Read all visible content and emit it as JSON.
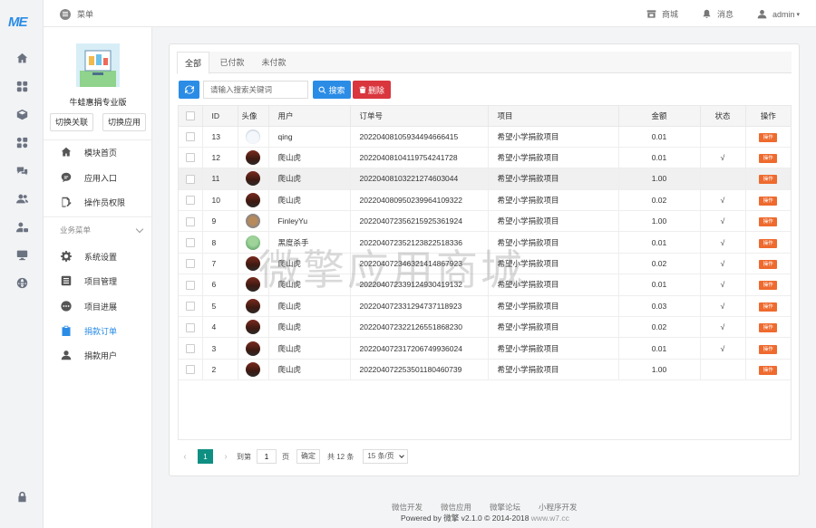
{
  "brand": {
    "logo_text": "ME"
  },
  "topbar": {
    "menu_label": "菜单",
    "store_label": "商城",
    "message_label": "消息",
    "user_label": "admin"
  },
  "sidebar": {
    "app_name": "牛蛙惠捐专业版",
    "switch_link_label": "切换关联",
    "switch_app_label": "切换应用",
    "top_items": [
      {
        "label": "模块首页",
        "icon": "home-icon"
      },
      {
        "label": "应用入口",
        "icon": "chat-icon"
      },
      {
        "label": "操作员权限",
        "icon": "edit-icon"
      }
    ],
    "group_title": "业务菜单",
    "group_items": [
      {
        "label": "系统设置",
        "icon": "gear-icon"
      },
      {
        "label": "项目管理",
        "icon": "list-icon"
      },
      {
        "label": "项目进展",
        "icon": "dots-icon"
      },
      {
        "label": "捐款订单",
        "icon": "clipboard-icon",
        "active": true
      },
      {
        "label": "捐款用户",
        "icon": "user-icon"
      }
    ]
  },
  "tabs": [
    {
      "label": "全部",
      "active": true
    },
    {
      "label": "已付款"
    },
    {
      "label": "未付款"
    }
  ],
  "toolbar": {
    "search_placeholder": "请输入搜索关键词",
    "search_label": "搜索",
    "delete_label": "删除"
  },
  "table": {
    "headers": [
      "ID",
      "头像",
      "用户",
      "订单号",
      "项目",
      "金额",
      "状态",
      "操作"
    ],
    "op_label": "操作",
    "rows": [
      {
        "id": "13",
        "avatar": "cloud",
        "user": "qing",
        "order": "20220408105934494666415",
        "project": "希望小学捐款项目",
        "amount": "0.01",
        "status": ""
      },
      {
        "id": "12",
        "avatar": "person",
        "user": "爬山虎",
        "order": "20220408104119754241728",
        "project": "希望小学捐款项目",
        "amount": "0.01",
        "status": "√"
      },
      {
        "id": "11",
        "avatar": "person",
        "user": "爬山虎",
        "order": "20220408103221274603044?",
        "project": "希望小学捐款项目",
        "amount": "1.00",
        "status": "",
        "highlight": true
      },
      {
        "id": "10",
        "avatar": "person",
        "user": "爬山虎",
        "order": "20220408095023996410932​2",
        "project": "希望小学捐款项目",
        "amount": "0.02",
        "status": "√"
      },
      {
        "id": "9",
        "avatar": "dog",
        "user": "FinleyYu",
        "order": "20220407235621592536192​4",
        "project": "希望小学捐款项目",
        "amount": "1.00",
        "status": "√"
      },
      {
        "id": "8",
        "avatar": "green",
        "user": "黑度杀手",
        "order": "20220407235212382251833​6",
        "project": "希望小学捐款项目",
        "amount": "0.01",
        "status": "√"
      },
      {
        "id": "7",
        "avatar": "person",
        "user": "爬山虎",
        "order": "20220407234632141486792​3",
        "project": "希望小学捐款项目",
        "amount": "0.02",
        "status": "√"
      },
      {
        "id": "6",
        "avatar": "person",
        "user": "爬山虎",
        "order": "20220407233912493041913​2",
        "project": "希望小学捐款项目",
        "amount": "0.01",
        "status": "√"
      },
      {
        "id": "5",
        "avatar": "person",
        "user": "爬山虎",
        "order": "20220407233129473711892​3",
        "project": "希望小学捐款项目",
        "amount": "0.03",
        "status": "√"
      },
      {
        "id": "4",
        "avatar": "person",
        "user": "爬山虎",
        "order": "20220407232212655186823​0",
        "project": "希望小学捐款项目",
        "amount": "0.02",
        "status": "√"
      },
      {
        "id": "3",
        "avatar": "person",
        "user": "爬山虎",
        "order": "20220407231720674993602​4",
        "project": "希望小学捐款项目",
        "amount": "0.01",
        "status": "√"
      },
      {
        "id": "2",
        "avatar": "person",
        "user": "爬山虎",
        "order": "20220407225350118046073​9",
        "project": "希望小学捐款项目",
        "amount": "1.00",
        "status": ""
      }
    ]
  },
  "pager": {
    "current": "1",
    "goto_label": "到第",
    "goto_value": "1",
    "page_unit": "页",
    "confirm_label": "确定",
    "total_label": "共 12 条",
    "page_size": "15 条/页"
  },
  "footer": {
    "links": [
      "微信开发",
      "微信应用",
      "微擎论坛",
      "小程序开发"
    ],
    "powered": "Powered by",
    "brand": "微擎 v2.1.0 © 2014-2018",
    "site": "www.w7.cc"
  },
  "watermark": "微擎应用商城",
  "colors": {
    "primary": "#2b8ce6",
    "danger": "#d9363e",
    "pager_active": "#0e8f82",
    "op_button": "#ee6a2e"
  }
}
